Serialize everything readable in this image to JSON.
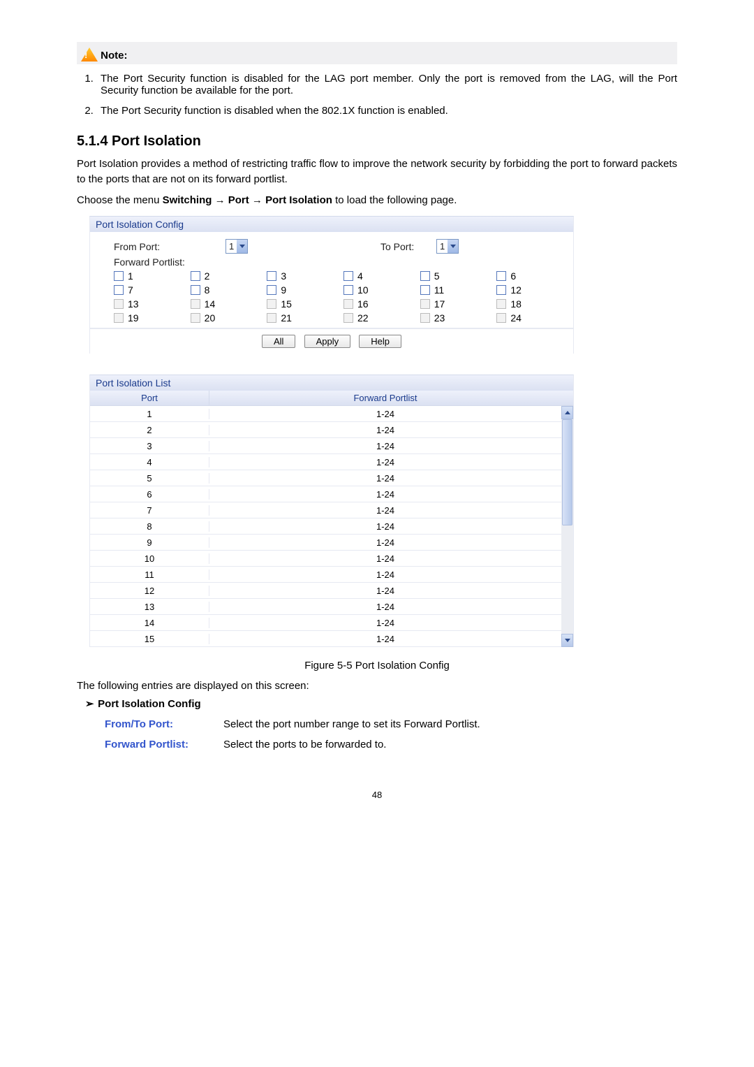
{
  "note": {
    "label": "Note:",
    "items": [
      "The Port Security function is disabled for the LAG port member. Only the port is removed from the LAG, will the Port Security function be available for the port.",
      "The Port Security function is disabled when the 802.1X function is enabled."
    ]
  },
  "section": {
    "heading": "5.1.4 Port Isolation",
    "para1": "Port Isolation provides a method of restricting traffic flow to improve the network security by forbidding the port to forward packets to the ports that are not on its forward portlist.",
    "para2_pre": "Choose the menu ",
    "para2_bold": "Switching → Port → Port Isolation",
    "para2_post": " to load the following page."
  },
  "config_panel": {
    "title": "Port Isolation Config",
    "from_label": "From Port:",
    "from_value": "1",
    "to_label": "To Port:",
    "to_value": "1",
    "fwd_label": "Forward Portlist:",
    "ports": [
      [
        "1",
        "2",
        "3",
        "4",
        "5",
        "6"
      ],
      [
        "7",
        "8",
        "9",
        "10",
        "11",
        "12"
      ],
      [
        "13",
        "14",
        "15",
        "16",
        "17",
        "18"
      ],
      [
        "19",
        "20",
        "21",
        "22",
        "23",
        "24"
      ]
    ],
    "disabled_rows": [
      2,
      3
    ],
    "btn_all": "All",
    "btn_apply": "Apply",
    "btn_help": "Help"
  },
  "list_panel": {
    "title": "Port Isolation List",
    "col_port": "Port",
    "col_fwd": "Forward Portlist",
    "rows": [
      {
        "port": "1",
        "fwd": "1-24"
      },
      {
        "port": "2",
        "fwd": "1-24"
      },
      {
        "port": "3",
        "fwd": "1-24"
      },
      {
        "port": "4",
        "fwd": "1-24"
      },
      {
        "port": "5",
        "fwd": "1-24"
      },
      {
        "port": "6",
        "fwd": "1-24"
      },
      {
        "port": "7",
        "fwd": "1-24"
      },
      {
        "port": "8",
        "fwd": "1-24"
      },
      {
        "port": "9",
        "fwd": "1-24"
      },
      {
        "port": "10",
        "fwd": "1-24"
      },
      {
        "port": "11",
        "fwd": "1-24"
      },
      {
        "port": "12",
        "fwd": "1-24"
      },
      {
        "port": "13",
        "fwd": "1-24"
      },
      {
        "port": "14",
        "fwd": "1-24"
      },
      {
        "port": "15",
        "fwd": "1-24"
      }
    ]
  },
  "figure_caption": "Figure 5-5 Port Isolation Config",
  "entries_text": "The following entries are displayed on this screen:",
  "bullet_title": "Port Isolation Config",
  "fields": [
    {
      "name": "From/To Port:",
      "desc": "Select the port number range to set its Forward Portlist."
    },
    {
      "name": "Forward Portlist:",
      "desc": "Select the ports to be forwarded to."
    }
  ],
  "page_number": "48"
}
